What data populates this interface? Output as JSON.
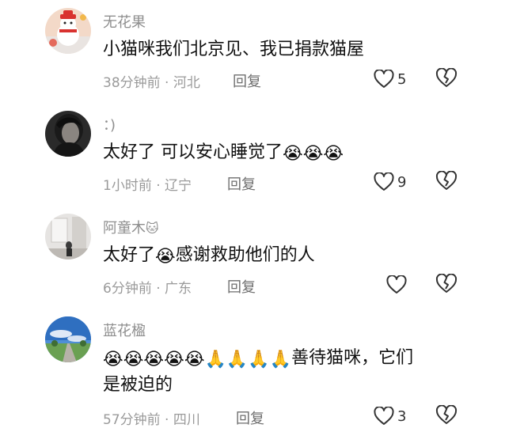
{
  "comments": [
    {
      "username": "无花果",
      "username_emoji": "",
      "text_lines": [
        "小猫咪我们北京见、我已捐款猫屋"
      ],
      "emoji_text": "",
      "time": "38分钟前",
      "location": "河北",
      "reply_label": "回复",
      "like_count": "5",
      "avatar": "avatar-cartoon-snowman"
    },
    {
      "username": "：)",
      "username_emoji": "",
      "text_lines": [
        "太好了 可以安心睡觉了"
      ],
      "emoji_text": "😭😭😭",
      "time": "1小时前",
      "location": "辽宁",
      "reply_label": "回复",
      "like_count": "9",
      "avatar": "avatar-dark-portrait"
    },
    {
      "username": "阿童木",
      "username_emoji": "🐱",
      "text_before": "太好了",
      "emoji_mid": "😭",
      "text_after": "感谢救助他们的人",
      "time": "6分钟前",
      "location": "广东",
      "reply_label": "回复",
      "like_count": "",
      "avatar": "avatar-room-photo"
    },
    {
      "username": "蓝花楹",
      "username_emoji": "",
      "emoji_lead": "😭😭😭😭😭🙏🙏🙏🙏",
      "text_line1": "善待猫咪，它们",
      "text_line2": "是被迫的",
      "time": "57分钟前",
      "location": "四川",
      "reply_label": "回复",
      "like_count": "3",
      "avatar": "avatar-sky-landscape"
    }
  ],
  "icons": {
    "like": "heart-outline-icon",
    "dislike": "broken-heart-icon"
  },
  "colors": {
    "username": "#8e8e8e",
    "meta": "#9a9a9a",
    "icon_stroke": "#333333"
  }
}
